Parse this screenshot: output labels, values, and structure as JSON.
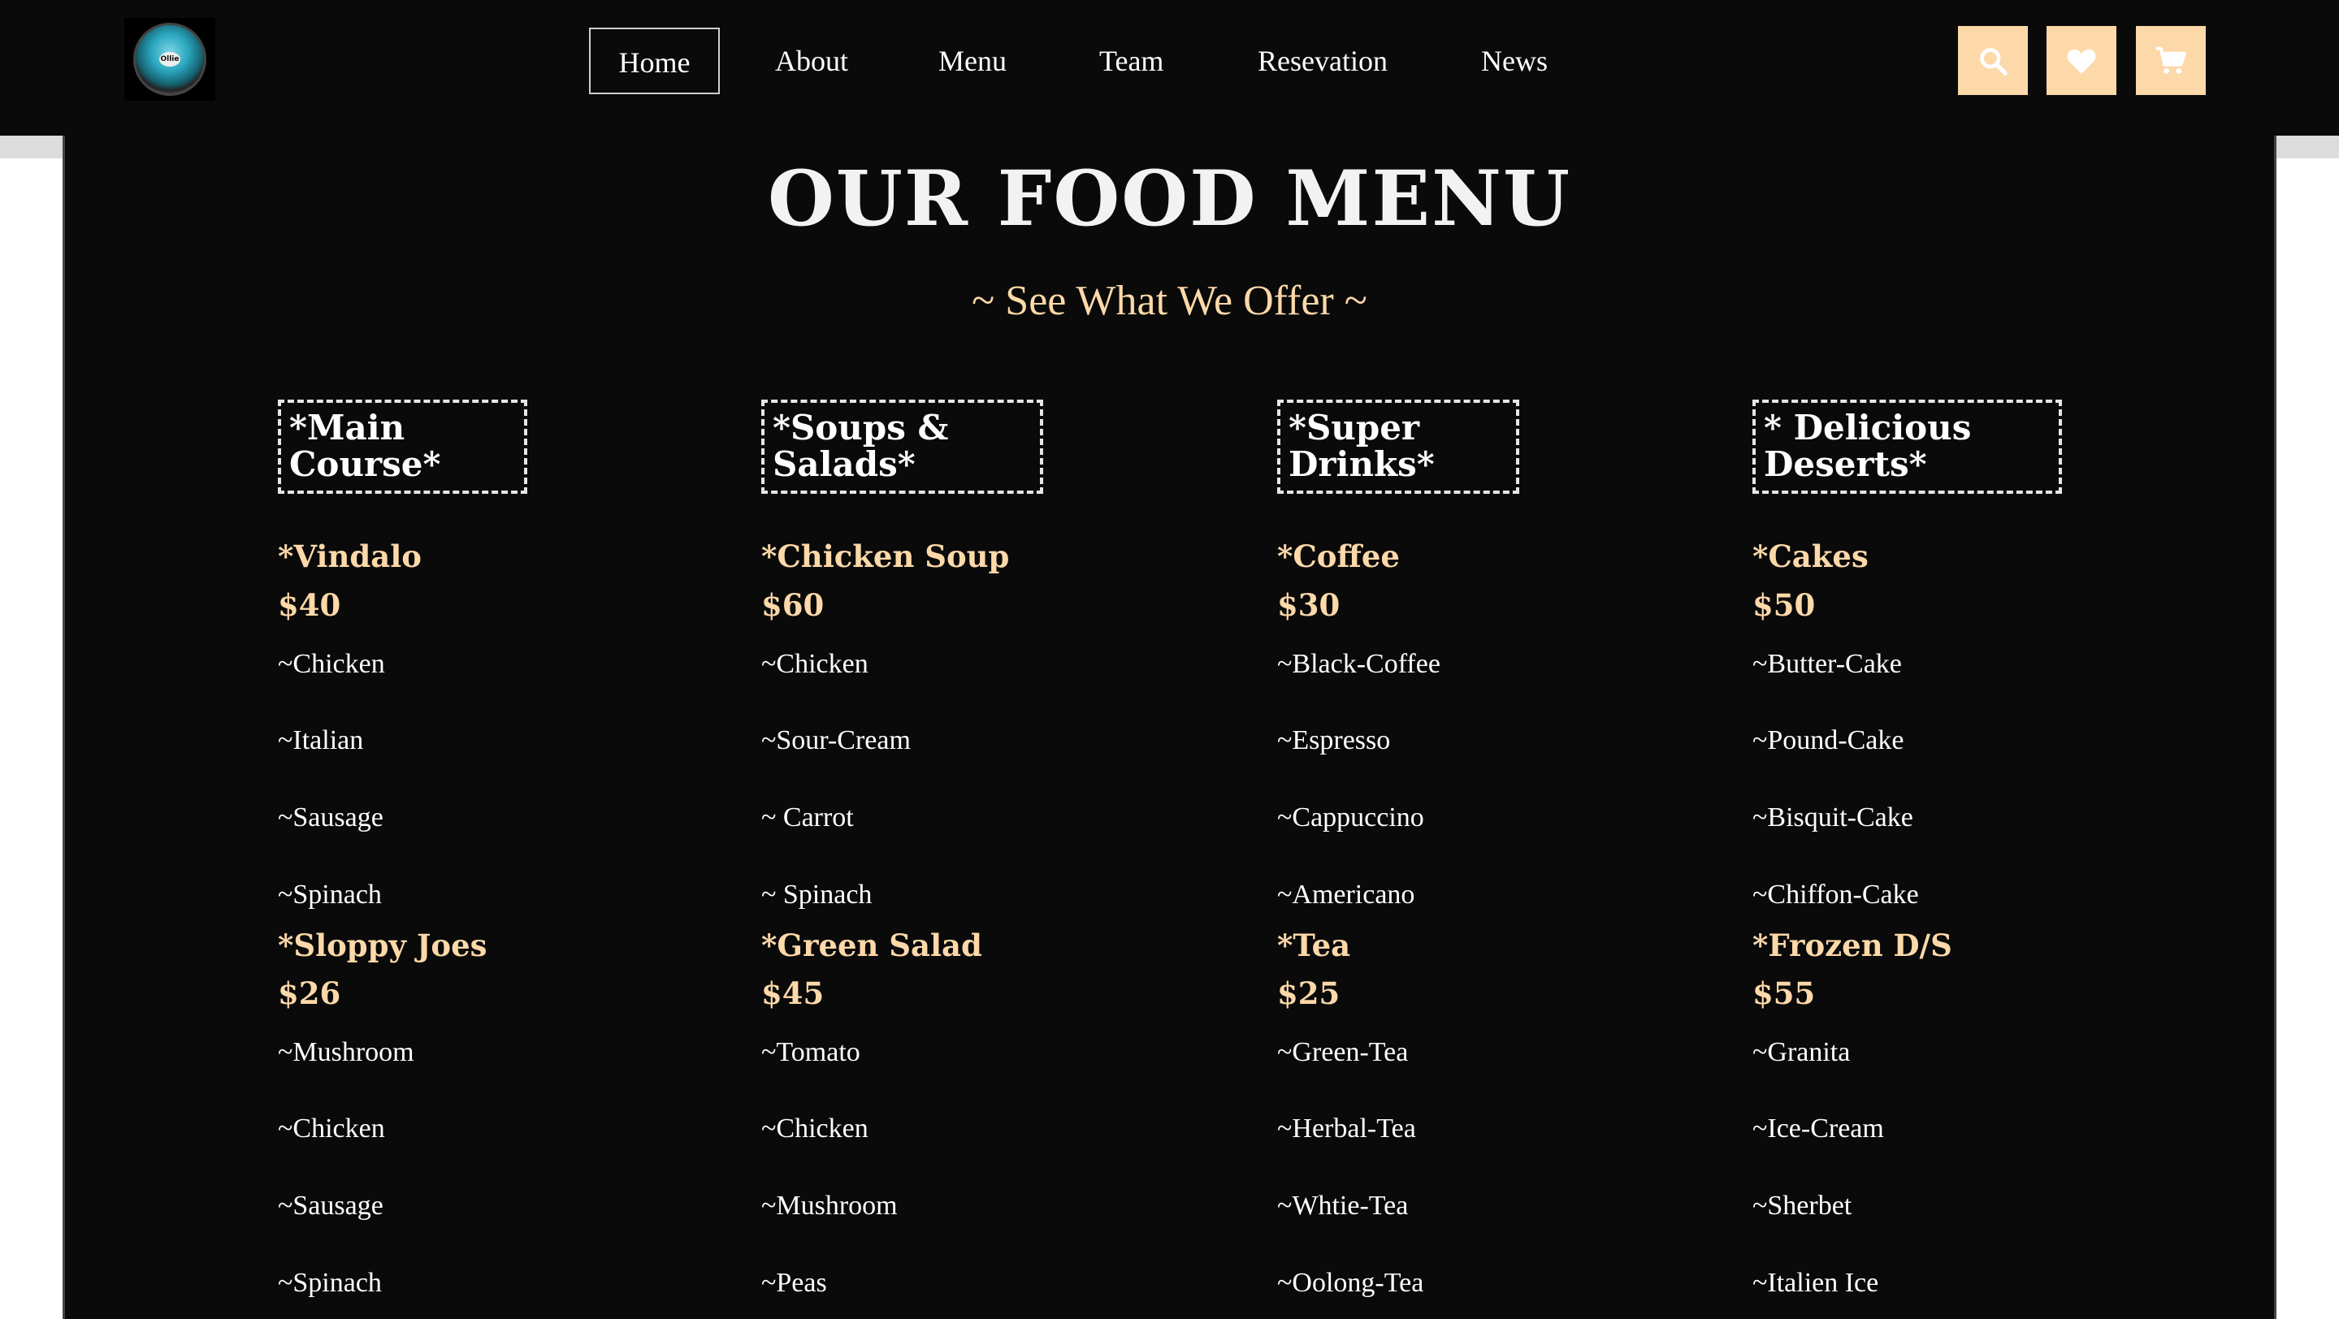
{
  "logo": {
    "text": "Ollie"
  },
  "nav": {
    "items": [
      "Home",
      "About",
      "Menu",
      "Team",
      "Resevation",
      "News"
    ],
    "active": "Home"
  },
  "actions": {
    "icons": [
      "search-icon",
      "heart-icon",
      "cart-icon"
    ]
  },
  "colors": {
    "accent": "#fdd8a8",
    "background": "#0a0a0a",
    "text": "#ffffff"
  },
  "header": {
    "title": "OUR FOOD MENU",
    "subtitle": "~ See What We Offer ~"
  },
  "categories": [
    {
      "title_lines": [
        "*Main",
        "Course*"
      ],
      "items": [
        {
          "name": "*Vindalo",
          "price": "$40",
          "ingredients": [
            "~Chicken",
            "~Italian",
            "~Sausage",
            "~Spinach"
          ]
        },
        {
          "name": "*Sloppy Joes",
          "price": "$26",
          "ingredients": [
            "~Mushroom",
            "~Chicken",
            "~Sausage",
            "~Spinach"
          ]
        }
      ]
    },
    {
      "title_lines": [
        "*Soups &",
        "Salads*"
      ],
      "items": [
        {
          "name": "*Chicken Soup",
          "price": "$60",
          "ingredients": [
            "~Chicken",
            "~Sour-Cream",
            "~ Carrot",
            "~ Spinach"
          ]
        },
        {
          "name": "*Green Salad",
          "price": "$45",
          "ingredients": [
            "~Tomato",
            "~Chicken",
            "~Mushroom",
            "~Peas"
          ]
        }
      ]
    },
    {
      "title_lines": [
        "*Super",
        "Drinks*"
      ],
      "items": [
        {
          "name": "*Coffee",
          "price": "$30",
          "ingredients": [
            "~Black-Coffee",
            "~Espresso",
            "~Cappuccino",
            "~Americano"
          ]
        },
        {
          "name": "*Tea",
          "price": "$25",
          "ingredients": [
            "~Green-Tea",
            "~Herbal-Tea",
            "~Whtie-Tea",
            "~Oolong-Tea"
          ]
        }
      ]
    },
    {
      "title_lines": [
        "* Delicious",
        "Deserts*"
      ],
      "items": [
        {
          "name": "*Cakes",
          "price": "$50",
          "ingredients": [
            "~Butter-Cake",
            "~Pound-Cake",
            "~Bisquit-Cake",
            "~Chiffon-Cake"
          ]
        },
        {
          "name": "*Frozen D/S",
          "price": "$55",
          "ingredients": [
            "~Granita",
            "~Ice-Cream",
            "~Sherbet",
            "~Italien Ice"
          ]
        }
      ]
    }
  ]
}
